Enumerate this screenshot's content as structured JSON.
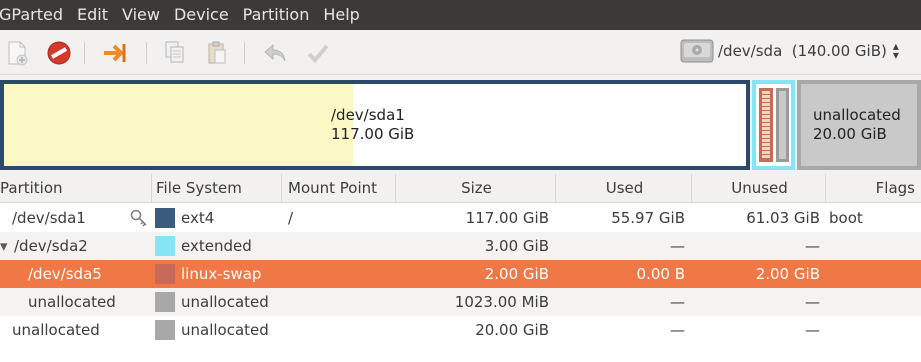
{
  "menu": [
    "GParted",
    "Edit",
    "View",
    "Device",
    "Partition",
    "Help"
  ],
  "device": {
    "label": "/dev/sda  (140.00 GiB)"
  },
  "map": {
    "sda1": {
      "name": "/dev/sda1",
      "size": "117.00 GiB",
      "used_fraction": 0.47
    },
    "unallocated": {
      "name": "unallocated",
      "size": "20.00 GiB"
    }
  },
  "columns": [
    "Partition",
    "File System",
    "Mount Point",
    "Size",
    "Used",
    "Unused",
    "Flags"
  ],
  "rows": [
    {
      "partition": "/dev/sda1",
      "fs": "ext4",
      "fs_color": "#3a5b7e",
      "mount": "/",
      "size": "117.00 GiB",
      "used": "55.97 GiB",
      "unused": "61.03 GiB",
      "flags": "boot"
    },
    {
      "expander": "▾",
      "partition": "/dev/sda2",
      "fs": "extended",
      "fs_color": "#87e4f5",
      "mount": "",
      "size": "3.00 GiB",
      "used": "—",
      "unused": "—",
      "flags": ""
    },
    {
      "partition": "/dev/sda5",
      "fs": "linux-swap",
      "fs_color": "#c76a5a",
      "mount": "",
      "size": "2.00 GiB",
      "used": "0.00 B",
      "unused": "2.00 GiB",
      "flags": ""
    },
    {
      "partition": "unallocated",
      "fs": "unallocated",
      "fs_color": "#a8a8a8",
      "mount": "",
      "size": "1023.00 MiB",
      "used": "—",
      "unused": "—",
      "flags": ""
    },
    {
      "partition": "unallocated",
      "fs": "unallocated",
      "fs_color": "#a8a8a8",
      "mount": "",
      "size": "20.00 GiB",
      "used": "—",
      "unused": "—",
      "flags": ""
    }
  ],
  "colors": {
    "selection": "#f07746",
    "menubar": "#3b3a36"
  }
}
